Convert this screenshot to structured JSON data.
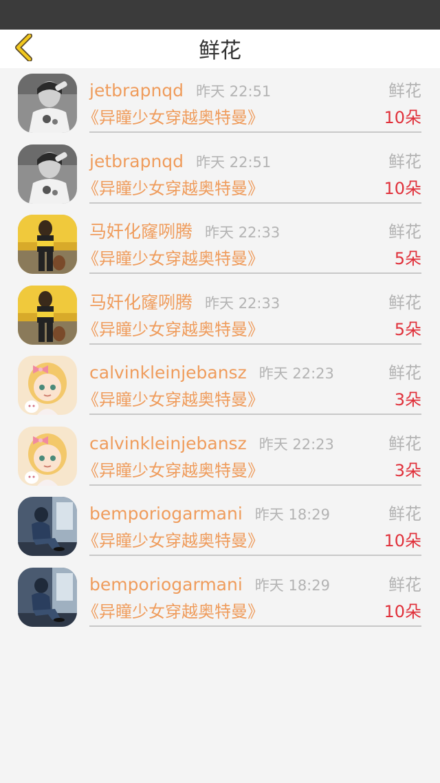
{
  "nav": {
    "title": "鲜花",
    "back_icon": "chevron-left-icon",
    "accent": "#f2c81e"
  },
  "colors": {
    "username": "#ef9c5c",
    "count": "#e0303a",
    "muted": "#b3b3b3"
  },
  "records": [
    {
      "avatar": "avatar-bw-girl",
      "username": "jetbrapnqd",
      "time": "昨天 22:51",
      "gift": "鲜花",
      "book": "《异瞳少女穿越奥特曼》",
      "count": "10朵"
    },
    {
      "avatar": "avatar-bw-girl",
      "username": "jetbrapnqd",
      "time": "昨天 22:51",
      "gift": "鲜花",
      "book": "《异瞳少女穿越奥特曼》",
      "count": "10朵"
    },
    {
      "avatar": "avatar-yellow-taxi",
      "username": "马奸化窿咧腾",
      "time": "昨天 22:33",
      "gift": "鲜花",
      "book": "《异瞳少女穿越奥特曼》",
      "count": "5朵"
    },
    {
      "avatar": "avatar-yellow-taxi",
      "username": "马奸化窿咧腾",
      "time": "昨天 22:33",
      "gift": "鲜花",
      "book": "《异瞳少女穿越奥特曼》",
      "count": "5朵"
    },
    {
      "avatar": "avatar-anime-girl",
      "username": "calvinkleinjebansz",
      "time": "昨天 22:23",
      "gift": "鲜花",
      "book": "《异瞳少女穿越奥特曼》",
      "count": "3朵"
    },
    {
      "avatar": "avatar-anime-girl",
      "username": "calvinkleinjebansz",
      "time": "昨天 22:23",
      "gift": "鲜花",
      "book": "《异瞳少女穿越奥特曼》",
      "count": "3朵"
    },
    {
      "avatar": "avatar-sitting-person",
      "username": "bemporiogarmani",
      "time": "昨天 18:29",
      "gift": "鲜花",
      "book": "《异瞳少女穿越奥特曼》",
      "count": "10朵"
    },
    {
      "avatar": "avatar-sitting-person",
      "username": "bemporiogarmani",
      "time": "昨天 18:29",
      "gift": "鲜花",
      "book": "《异瞳少女穿越奥特曼》",
      "count": "10朵"
    }
  ]
}
